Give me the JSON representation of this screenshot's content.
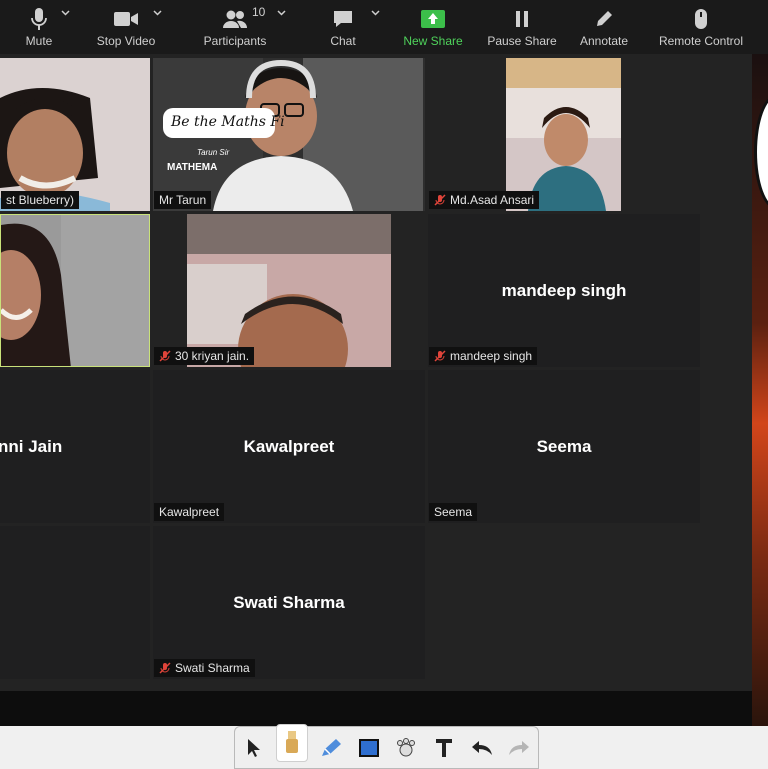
{
  "toolbar": {
    "mute": "Mute",
    "stop_video": "Stop Video",
    "participants": "Participants",
    "participants_count": "10",
    "chat": "Chat",
    "new_share": "New Share",
    "pause_share": "Pause Share",
    "annotate": "Annotate",
    "remote_control": "Remote Control"
  },
  "tiles": {
    "t1": {
      "label": "st Blueberry)"
    },
    "t2": {
      "label": "Mr Tarun",
      "banner_text": "Be the Maths Fi",
      "sub1": "Tarun Sir",
      "sub2": "MATHEMA"
    },
    "t3": {
      "label": "Md.Asad Ansari"
    },
    "t4": {
      "label": ""
    },
    "t5": {
      "label": "30 kriyan jain."
    },
    "t6": {
      "label": "mandeep singh",
      "name_big": "mandeep singh"
    },
    "t7": {
      "name_big": "nni Jain"
    },
    "t8": {
      "label": "Kawalpreet",
      "name_big": "Kawalpreet"
    },
    "t9": {
      "label": "Seema",
      "name_big": "Seema"
    },
    "t11": {
      "label": "Swati Sharma",
      "name_big": "Swati Sharma"
    }
  },
  "colors": {
    "toolbar_bg": "#1a1a1a",
    "share_green": "#4fd25b",
    "muted_red": "#e0443a",
    "active_speaker": "#c9e27a"
  },
  "annotate_tools": [
    "select-arrow-icon",
    "spotlight-icon",
    "eraser-pen-icon",
    "rectangle-icon",
    "stamp-icon",
    "text-icon",
    "undo-icon",
    "redo-icon"
  ]
}
